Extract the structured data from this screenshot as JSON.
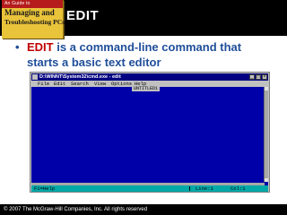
{
  "book": {
    "top_text": "An Guide to",
    "title_line1": "Managing and",
    "title_line2": "Troubleshooting PCs",
    "title_line3": ""
  },
  "slide": {
    "title": "EDIT",
    "bullet": "•",
    "keyword": "EDIT",
    "line1_rest": " is a command-line command that",
    "line2": "starts a basic text editor"
  },
  "window": {
    "title": "D:\\WINNT\\System32\\cmd.exe - edit",
    "menu": [
      "File",
      "Edit",
      "Search",
      "View",
      "Options",
      "Help"
    ],
    "doc_tab": "UNTITLED1",
    "status_help": "F1=Help",
    "status_line": "Line:1",
    "status_col": "Col:1",
    "colors": {
      "titlebar": "#000080",
      "document": "#0000a8",
      "statusbar": "#00a8a8"
    }
  },
  "footer": {
    "copyright": "© 2007 The McGraw-Hill Companies, Inc. All rights reserved"
  }
}
